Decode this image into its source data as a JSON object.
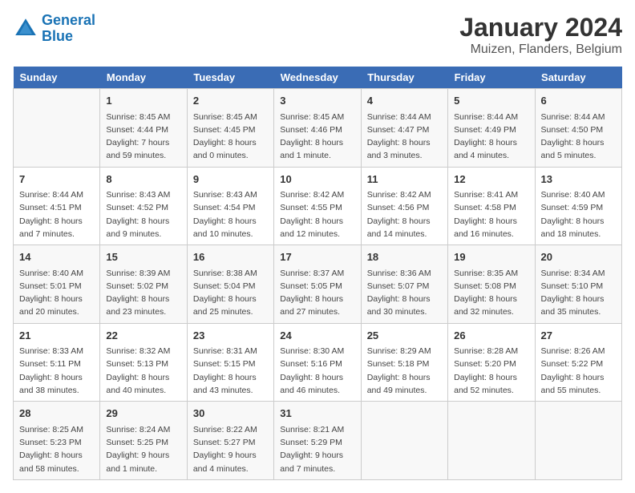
{
  "header": {
    "logo_line1": "General",
    "logo_line2": "Blue",
    "title": "January 2024",
    "subtitle": "Muizen, Flanders, Belgium"
  },
  "days_of_week": [
    "Sunday",
    "Monday",
    "Tuesday",
    "Wednesday",
    "Thursday",
    "Friday",
    "Saturday"
  ],
  "weeks": [
    [
      {
        "day": "",
        "info": ""
      },
      {
        "day": "1",
        "info": "Sunrise: 8:45 AM\nSunset: 4:44 PM\nDaylight: 7 hours\nand 59 minutes."
      },
      {
        "day": "2",
        "info": "Sunrise: 8:45 AM\nSunset: 4:45 PM\nDaylight: 8 hours\nand 0 minutes."
      },
      {
        "day": "3",
        "info": "Sunrise: 8:45 AM\nSunset: 4:46 PM\nDaylight: 8 hours\nand 1 minute."
      },
      {
        "day": "4",
        "info": "Sunrise: 8:44 AM\nSunset: 4:47 PM\nDaylight: 8 hours\nand 3 minutes."
      },
      {
        "day": "5",
        "info": "Sunrise: 8:44 AM\nSunset: 4:49 PM\nDaylight: 8 hours\nand 4 minutes."
      },
      {
        "day": "6",
        "info": "Sunrise: 8:44 AM\nSunset: 4:50 PM\nDaylight: 8 hours\nand 5 minutes."
      }
    ],
    [
      {
        "day": "7",
        "info": "Sunrise: 8:44 AM\nSunset: 4:51 PM\nDaylight: 8 hours\nand 7 minutes."
      },
      {
        "day": "8",
        "info": "Sunrise: 8:43 AM\nSunset: 4:52 PM\nDaylight: 8 hours\nand 9 minutes."
      },
      {
        "day": "9",
        "info": "Sunrise: 8:43 AM\nSunset: 4:54 PM\nDaylight: 8 hours\nand 10 minutes."
      },
      {
        "day": "10",
        "info": "Sunrise: 8:42 AM\nSunset: 4:55 PM\nDaylight: 8 hours\nand 12 minutes."
      },
      {
        "day": "11",
        "info": "Sunrise: 8:42 AM\nSunset: 4:56 PM\nDaylight: 8 hours\nand 14 minutes."
      },
      {
        "day": "12",
        "info": "Sunrise: 8:41 AM\nSunset: 4:58 PM\nDaylight: 8 hours\nand 16 minutes."
      },
      {
        "day": "13",
        "info": "Sunrise: 8:40 AM\nSunset: 4:59 PM\nDaylight: 8 hours\nand 18 minutes."
      }
    ],
    [
      {
        "day": "14",
        "info": "Sunrise: 8:40 AM\nSunset: 5:01 PM\nDaylight: 8 hours\nand 20 minutes."
      },
      {
        "day": "15",
        "info": "Sunrise: 8:39 AM\nSunset: 5:02 PM\nDaylight: 8 hours\nand 23 minutes."
      },
      {
        "day": "16",
        "info": "Sunrise: 8:38 AM\nSunset: 5:04 PM\nDaylight: 8 hours\nand 25 minutes."
      },
      {
        "day": "17",
        "info": "Sunrise: 8:37 AM\nSunset: 5:05 PM\nDaylight: 8 hours\nand 27 minutes."
      },
      {
        "day": "18",
        "info": "Sunrise: 8:36 AM\nSunset: 5:07 PM\nDaylight: 8 hours\nand 30 minutes."
      },
      {
        "day": "19",
        "info": "Sunrise: 8:35 AM\nSunset: 5:08 PM\nDaylight: 8 hours\nand 32 minutes."
      },
      {
        "day": "20",
        "info": "Sunrise: 8:34 AM\nSunset: 5:10 PM\nDaylight: 8 hours\nand 35 minutes."
      }
    ],
    [
      {
        "day": "21",
        "info": "Sunrise: 8:33 AM\nSunset: 5:11 PM\nDaylight: 8 hours\nand 38 minutes."
      },
      {
        "day": "22",
        "info": "Sunrise: 8:32 AM\nSunset: 5:13 PM\nDaylight: 8 hours\nand 40 minutes."
      },
      {
        "day": "23",
        "info": "Sunrise: 8:31 AM\nSunset: 5:15 PM\nDaylight: 8 hours\nand 43 minutes."
      },
      {
        "day": "24",
        "info": "Sunrise: 8:30 AM\nSunset: 5:16 PM\nDaylight: 8 hours\nand 46 minutes."
      },
      {
        "day": "25",
        "info": "Sunrise: 8:29 AM\nSunset: 5:18 PM\nDaylight: 8 hours\nand 49 minutes."
      },
      {
        "day": "26",
        "info": "Sunrise: 8:28 AM\nSunset: 5:20 PM\nDaylight: 8 hours\nand 52 minutes."
      },
      {
        "day": "27",
        "info": "Sunrise: 8:26 AM\nSunset: 5:22 PM\nDaylight: 8 hours\nand 55 minutes."
      }
    ],
    [
      {
        "day": "28",
        "info": "Sunrise: 8:25 AM\nSunset: 5:23 PM\nDaylight: 8 hours\nand 58 minutes."
      },
      {
        "day": "29",
        "info": "Sunrise: 8:24 AM\nSunset: 5:25 PM\nDaylight: 9 hours\nand 1 minute."
      },
      {
        "day": "30",
        "info": "Sunrise: 8:22 AM\nSunset: 5:27 PM\nDaylight: 9 hours\nand 4 minutes."
      },
      {
        "day": "31",
        "info": "Sunrise: 8:21 AM\nSunset: 5:29 PM\nDaylight: 9 hours\nand 7 minutes."
      },
      {
        "day": "",
        "info": ""
      },
      {
        "day": "",
        "info": ""
      },
      {
        "day": "",
        "info": ""
      }
    ]
  ]
}
